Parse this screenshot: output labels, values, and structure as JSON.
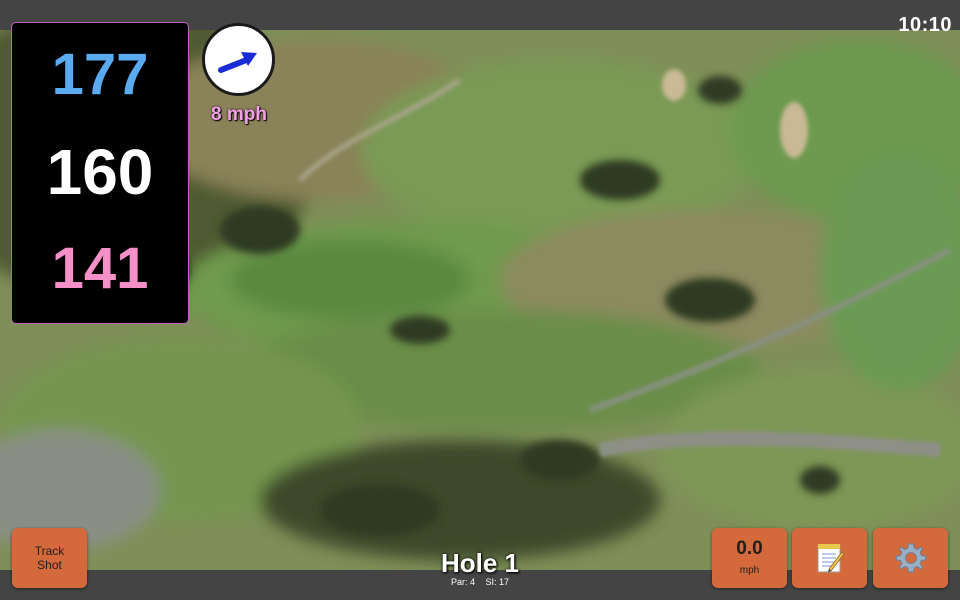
{
  "status_bar": {
    "time": "10:10"
  },
  "yardages": {
    "back": "177",
    "middle": "160",
    "front": "141"
  },
  "wind": {
    "speed": "8 mph",
    "arrow_color": "#1a2cd6",
    "speed_color": "#f4a0e8"
  },
  "buttons": {
    "track_shot": {
      "line1": "Track",
      "line2": "Shot"
    },
    "speed": {
      "value": "0.0",
      "unit": "mph"
    },
    "notes_icon": "notepad-icon",
    "settings_icon": "gear-icon"
  },
  "hole": {
    "title": "Hole 1",
    "par": "Par: 4",
    "stroke_index": "SI: 17"
  },
  "colors": {
    "back_yardage": "#5aaaf0",
    "middle_yardage": "#ffffff",
    "front_yardage": "#f48fc8",
    "button": "#d46a3c",
    "panel_border": "#c25fc2"
  }
}
